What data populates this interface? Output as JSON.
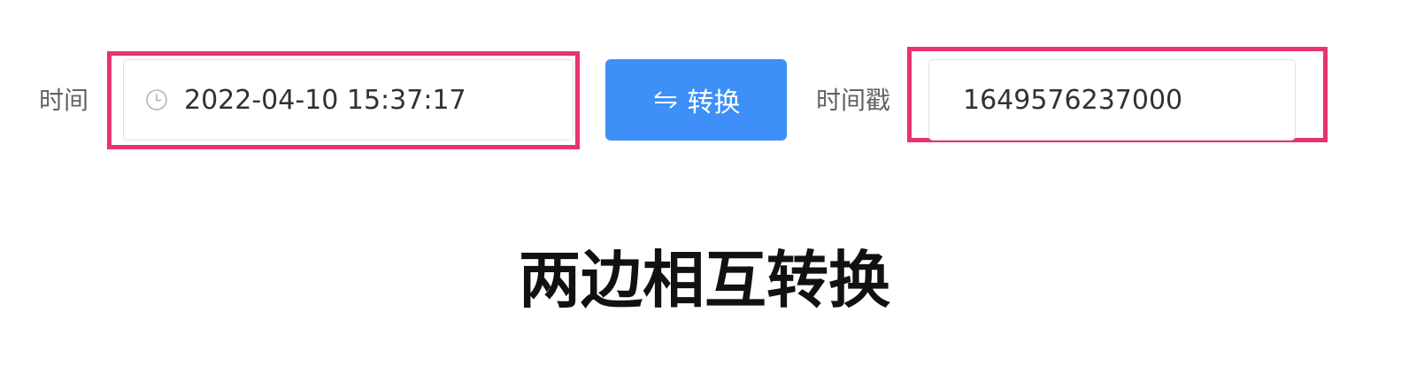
{
  "form": {
    "time_label": "时间",
    "time_value": "2022-04-10 15:37:17",
    "convert_label": "转换",
    "timestamp_label": "时间戳",
    "timestamp_value": "1649576237000"
  },
  "caption": "两边相互转换",
  "icons": {
    "time_field": "clock-icon",
    "convert_button": "swap-arrows-icon"
  },
  "colors": {
    "highlight": "#e8336f",
    "button": "#3e8ff7",
    "label_text": "#606266",
    "value_text": "#303133"
  }
}
